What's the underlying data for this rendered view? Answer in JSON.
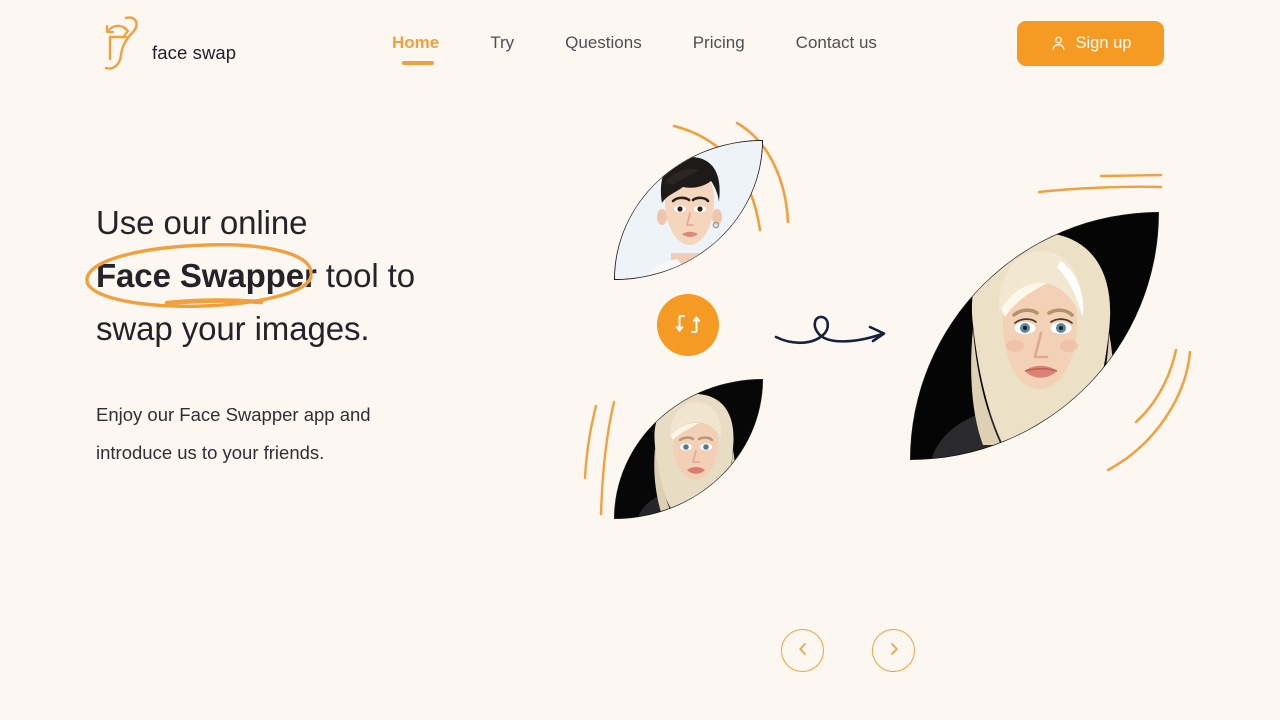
{
  "theme": {
    "background": "#FDF7F1",
    "accent": "#F59A23",
    "accent_light": "#EFA33F",
    "text_dark": "#232329",
    "text_muted": "#4E4E57",
    "ink": "#16213E"
  },
  "header": {
    "logo_icon": "face-swap-logo-icon",
    "brand_name": "face swap",
    "nav": [
      {
        "label": "Home",
        "active": true
      },
      {
        "label": "Try",
        "active": false
      },
      {
        "label": "Questions",
        "active": false
      },
      {
        "label": "Pricing",
        "active": false
      },
      {
        "label": "Contact us",
        "active": false
      }
    ],
    "signup": {
      "label": "Sign up",
      "icon": "user-icon"
    }
  },
  "hero": {
    "headline_line1": "Use our online",
    "headline_emphasis": "Face Swapper",
    "headline_line2_rest": " tool to",
    "headline_line3": "swap your images.",
    "highlight_style": "hand-drawn-orange-ellipse",
    "subcopy_line1": "Enjoy our Face Swapper app and",
    "subcopy_line2": "introduce us to your friends."
  },
  "showcase": {
    "source_image_alt": "young man portrait photo",
    "target_image_alt": "blonde woman portrait photo on black background",
    "result_image_alt": "face swap result portrait on black background",
    "swap_button": {
      "icon": "swap-arrows-icon",
      "label": ""
    },
    "transition_icon": "curly-arrow-right-icon",
    "decorations": [
      "orange-arc-pair-top",
      "orange-arc-pair-left",
      "orange-line-pair-top-right",
      "orange-arc-pair-bottom-right"
    ]
  },
  "carousel": {
    "prev": {
      "icon": "chevron-left-icon",
      "label": ""
    },
    "next": {
      "icon": "chevron-right-icon",
      "label": ""
    }
  }
}
